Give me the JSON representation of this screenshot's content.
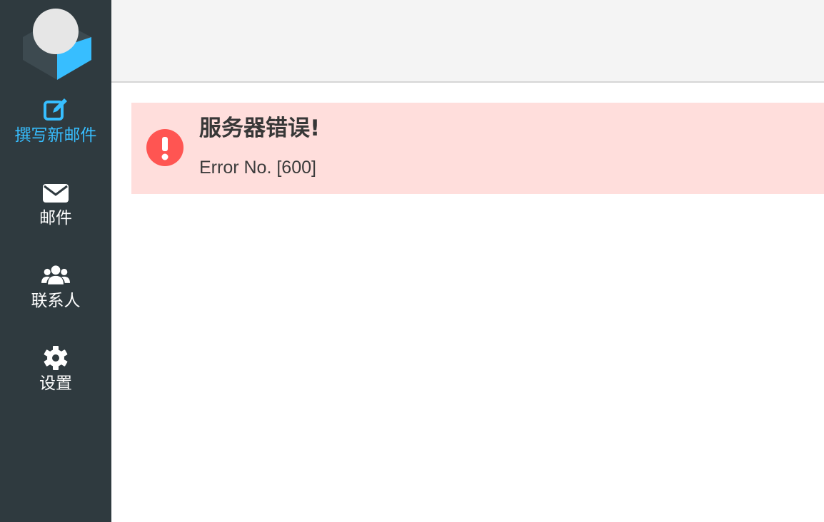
{
  "sidebar": {
    "items": [
      {
        "label": "撰写新邮件",
        "icon": "compose-icon",
        "active": true
      },
      {
        "label": "邮件",
        "icon": "envelope-icon",
        "active": false
      },
      {
        "label": "联系人",
        "icon": "contacts-icon",
        "active": false
      },
      {
        "label": "设置",
        "icon": "gear-icon",
        "active": false
      }
    ]
  },
  "error": {
    "title": "服务器错误!",
    "message": "Error No. [600]",
    "icon": "exclamation-icon"
  },
  "colors": {
    "sidebar_bg": "#2f3a3f",
    "accent": "#37beff",
    "error_bg": "#ffdedc",
    "error_icon": "#ff5552",
    "topbar_bg": "#f4f4f4"
  }
}
